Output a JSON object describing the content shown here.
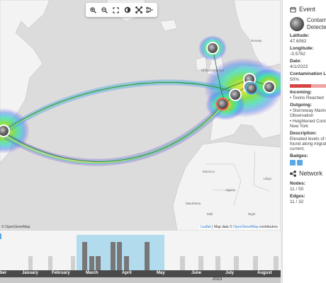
{
  "map": {
    "toolbar": [
      "zoom-in",
      "zoom-out",
      "fit",
      "theme",
      "network",
      "filter"
    ],
    "labels": {
      "uk": "United Kingdom",
      "norway": "Norway",
      "algeria": "Algeria",
      "morocco": "Morocco",
      "mali": "Mali",
      "niger": "Niger",
      "libya": "Libya",
      "mauritania": "Mauritania"
    },
    "attribution_left": "© OpenStreetMap",
    "attribution_leaflet": "Leaflet",
    "attribution_sep": " | Map data © ",
    "attribution_osm": "OpenStreetMap",
    "attribution_end": " contributors",
    "colors": {
      "heat_outer": "#7b4fd6",
      "heat_mid": "#38d9b6",
      "heat_inner": "#ffe53b",
      "edge": "#2a6f3a"
    }
  },
  "panel": {
    "header": "Event",
    "title": "Contamination Detected",
    "latitude_label": "Latitude:",
    "latitude": "47.6062",
    "longitude_label": "Longitude:",
    "longitude": "-3.5762",
    "date_label": "Date:",
    "date": "4/1/2023",
    "contamination_label": "Contamination Level:",
    "contamination": "50%",
    "contamination_fraction": 0.5,
    "incoming_label": "Incoming:",
    "incoming": [
      "Toxins Reached"
    ],
    "outgoing_label": "Outgoing:",
    "outgoing": [
      "Stornoway Marine Observation",
      "Heightened Contamination New York"
    ],
    "description_label": "Description:",
    "description": "Elevated levels of toxins found along migration current.",
    "badges_label": "Badges:",
    "network_header": "Network",
    "nodes_label": "Nodes:",
    "nodes": "11 / 50",
    "edges_label": "Edges:",
    "edges": "11 / 32"
  },
  "timeline": {
    "months": [
      "ber",
      "January",
      "February",
      "March",
      "April",
      "May",
      "June",
      "July",
      "August"
    ],
    "year": "2023"
  }
}
